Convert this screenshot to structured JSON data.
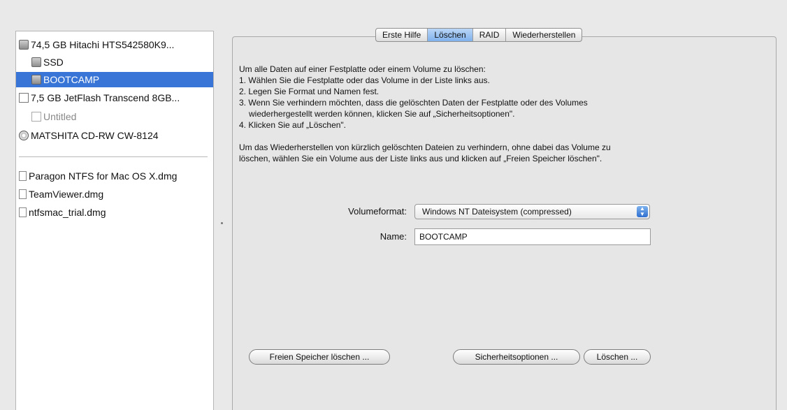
{
  "sidebar": {
    "devices": [
      {
        "label": "74,5 GB Hitachi HTS542580K9...",
        "icon": "hard-disk-icon"
      },
      {
        "label": "SSD",
        "icon": "volume-icon"
      },
      {
        "label": "BOOTCAMP",
        "icon": "volume-icon",
        "selected": true
      },
      {
        "label": "7,5 GB JetFlash Transcend 8GB...",
        "icon": "usb-drive-icon"
      },
      {
        "label": "Untitled",
        "icon": "volume-icon"
      },
      {
        "label": "MATSHITA CD-RW CW-8124",
        "icon": "optical-drive-icon"
      }
    ],
    "images": [
      {
        "label": "Paragon NTFS for Mac OS X.dmg",
        "icon": "disk-image-icon"
      },
      {
        "label": "TeamViewer.dmg",
        "icon": "disk-image-icon"
      },
      {
        "label": "ntfsmac_trial.dmg",
        "icon": "disk-image-icon"
      }
    ]
  },
  "tabs": [
    {
      "label": "Erste Hilfe"
    },
    {
      "label": "Löschen",
      "active": true
    },
    {
      "label": "RAID"
    },
    {
      "label": "Wiederherstellen"
    }
  ],
  "info": {
    "intro": "Um alle Daten auf einer Festplatte oder einem Volume zu löschen:",
    "step1": "1. Wählen Sie die Festplatte oder das Volume in der Liste links aus.",
    "step2": "2. Legen Sie Format und Namen fest.",
    "step3a": "3. Wenn Sie verhindern möchten, dass die gelöschten Daten der Festplatte oder des Volumes",
    "step3b": "wiederhergestellt werden können, klicken Sie auf „Sicherheitsoptionen\".",
    "step4": "4. Klicken Sie auf „Löschen\".",
    "free1": "Um das Wiederherstellen von kürzlich gelöschten Dateien zu verhindern, ohne dabei das Volume zu",
    "free2": "löschen, wählen Sie ein Volume aus der Liste links aus und klicken auf „Freien Speicher löschen\"."
  },
  "form": {
    "format_label": "Volumeformat:",
    "format_value": "Windows NT Dateisystem (compressed)",
    "name_label": "Name:",
    "name_value": "BOOTCAMP"
  },
  "buttons": {
    "erase_free": "Freien Speicher löschen ...",
    "security": "Sicherheitsoptionen ...",
    "erase": "Löschen ..."
  },
  "colors": {
    "selection": "#3875d7",
    "active_tab": "#7fb1ec"
  }
}
